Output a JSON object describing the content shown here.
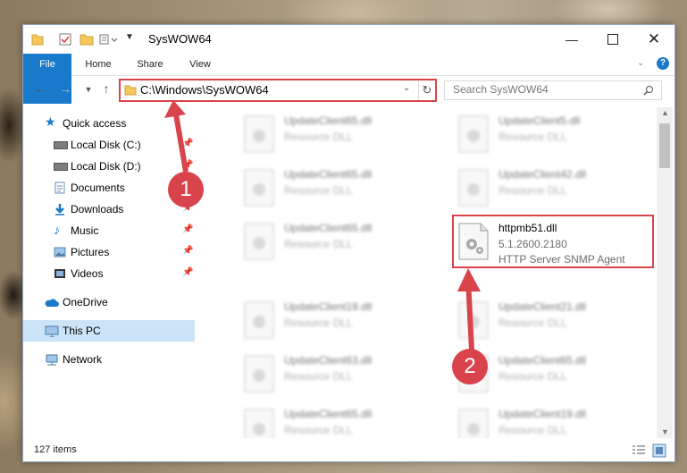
{
  "window": {
    "title": "SysWOW64"
  },
  "ribbon": {
    "tabs": [
      "File",
      "Home",
      "Share",
      "View"
    ]
  },
  "address": {
    "path": "C:\\Windows\\SysWOW64"
  },
  "search": {
    "placeholder": "Search SysWOW64"
  },
  "nav": {
    "items": [
      {
        "label": "Quick access"
      },
      {
        "label": "Local Disk (C:)"
      },
      {
        "label": "Local Disk (D:)"
      },
      {
        "label": "Documents"
      },
      {
        "label": "Downloads"
      },
      {
        "label": "Music"
      },
      {
        "label": "Pictures"
      },
      {
        "label": "Videos"
      },
      {
        "label": "OneDrive"
      },
      {
        "label": "This PC"
      },
      {
        "label": "Network"
      }
    ]
  },
  "files": [
    {
      "name": "UpdateClient65.dll",
      "desc": "Resource DLL"
    },
    {
      "name": "UpdateClient5.dll",
      "desc": "Resource DLL"
    },
    {
      "name": "UpdateClient65.dll",
      "desc": "Resource DLL"
    },
    {
      "name": "UpdateClient42.dll",
      "desc": "Resource DLL"
    },
    {
      "name": "UpdateClient65.dll",
      "desc": "Resource DLL"
    },
    {
      "name": "httpmb51.dll",
      "version": "5.1.2600.2180",
      "desc": "HTTP Server SNMP Agent"
    },
    {
      "name": "UpdateClient19.dll",
      "desc": "Resource DLL"
    },
    {
      "name": "UpdateClient21.dll",
      "desc": "Resource DLL"
    },
    {
      "name": "UpdateClient63.dll",
      "desc": "Resource DLL"
    },
    {
      "name": "UpdateClient65.dll",
      "desc": "Resource DLL"
    },
    {
      "name": "UpdateClient65.dll",
      "desc": "Resource DLL"
    },
    {
      "name": "UpdateClient19.dll",
      "desc": "Resource DLL"
    }
  ],
  "status": {
    "count": "127 items"
  },
  "annotations": {
    "step1": "1",
    "step2": "2"
  },
  "colors": {
    "accent": "#1979ca",
    "highlight": "#d9434b",
    "selected": "#cce4f7"
  }
}
